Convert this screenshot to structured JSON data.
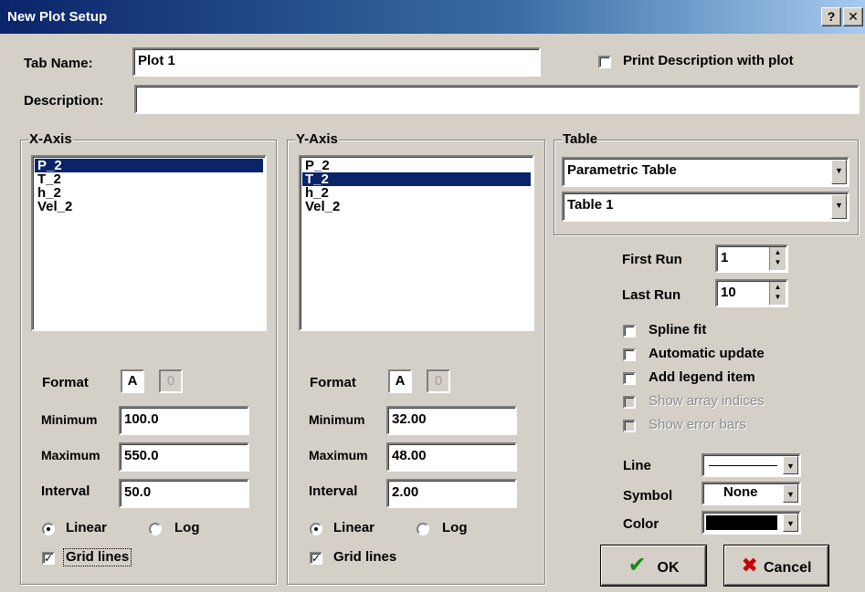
{
  "window": {
    "title": "New Plot Setup",
    "help_glyph": "?",
    "close_glyph": "✕"
  },
  "tab_name": {
    "label": "Tab Name:",
    "value": "Plot 1"
  },
  "print_description": {
    "label": "Print Description with plot",
    "checked": false
  },
  "description": {
    "label": "Description:",
    "value": ""
  },
  "x_axis": {
    "title": "X-Axis",
    "items": [
      "P_2",
      "T_2",
      "h_2",
      "Vel_2"
    ],
    "selected_index": 0,
    "format": {
      "label": "Format",
      "a": "A",
      "zero": "0"
    },
    "minimum": {
      "label": "Minimum",
      "value": "100.0"
    },
    "maximum": {
      "label": "Maximum",
      "value": "550.0"
    },
    "interval": {
      "label": "Interval",
      "value": "50.0"
    },
    "linear_label": "Linear",
    "log_label": "Log",
    "scale": "Linear",
    "grid_lines": {
      "label": "Grid lines",
      "checked": true
    }
  },
  "y_axis": {
    "title": "Y-Axis",
    "items": [
      "P_2",
      "T_2",
      "h_2",
      "Vel_2"
    ],
    "selected_index": 1,
    "format": {
      "label": "Format",
      "a": "A",
      "zero": "0"
    },
    "minimum": {
      "label": "Minimum",
      "value": "32.00"
    },
    "maximum": {
      "label": "Maximum",
      "value": "48.00"
    },
    "interval": {
      "label": "Interval",
      "value": "2.00"
    },
    "linear_label": "Linear",
    "log_label": "Log",
    "scale": "Linear",
    "grid_lines": {
      "label": "Grid lines",
      "checked": true
    }
  },
  "table": {
    "title": "Table",
    "type_value": "Parametric Table",
    "table_value": "Table 1"
  },
  "first_run": {
    "label": "First Run",
    "value": "1"
  },
  "last_run": {
    "label": "Last Run",
    "value": "10"
  },
  "options": [
    {
      "label": "Spline fit",
      "checked": false,
      "enabled": true
    },
    {
      "label": "Automatic update",
      "checked": false,
      "enabled": true
    },
    {
      "label": "Add legend item",
      "checked": false,
      "enabled": true
    },
    {
      "label": "Show array indices",
      "checked": false,
      "enabled": false
    },
    {
      "label": "Show error bars",
      "checked": false,
      "enabled": false
    }
  ],
  "line": {
    "label": "Line"
  },
  "symbol": {
    "label": "Symbol",
    "value": "None"
  },
  "color": {
    "label": "Color",
    "value": "#000000"
  },
  "ok_button": {
    "label": "OK",
    "icon_color": "#1a8a1a"
  },
  "cancel_button": {
    "label": "Cancel",
    "icon_color": "#cc0000"
  },
  "colors": {
    "selection": "#0a246a",
    "dialog_bg": "#d4d0c8"
  }
}
